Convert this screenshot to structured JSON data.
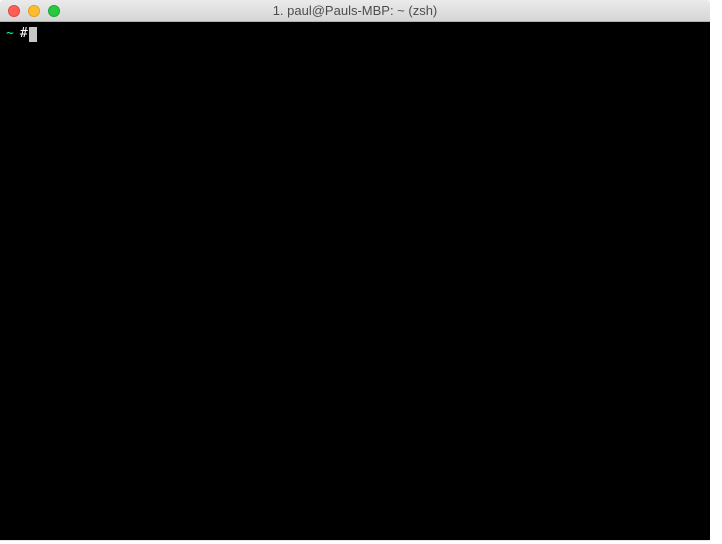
{
  "window": {
    "title": "1. paul@Pauls-MBP: ~ (zsh)"
  },
  "terminal": {
    "prompt_path": "~",
    "prompt_command": "#"
  }
}
